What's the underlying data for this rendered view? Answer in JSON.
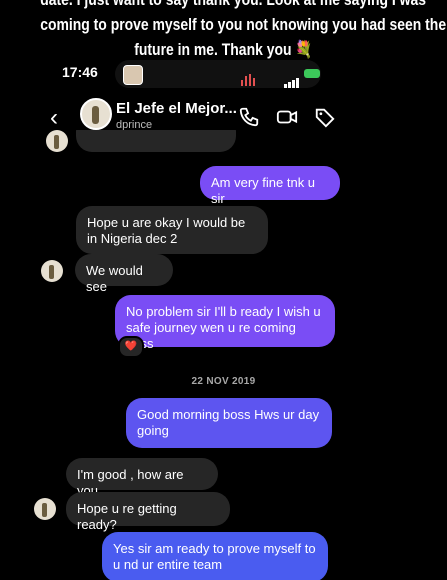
{
  "caption": {
    "line1": "date. I just want to say thank you. Look at me saying I was",
    "line2": "coming to prove myself to you not knowing you had seen the",
    "line3": "future in me. Thank you 💐"
  },
  "status_bar": {
    "time": "17:46"
  },
  "header": {
    "back_icon": "chevron-left-icon",
    "name": "El Jefe el Mejor...",
    "username": "dprince",
    "icons": [
      "phone-icon",
      "video-icon",
      "tag-icon"
    ]
  },
  "messages": [
    {
      "side": "in",
      "text": ""
    },
    {
      "side": "out",
      "text": "Am very fine tnk u sir"
    },
    {
      "side": "in",
      "text": "Hope u are okay I would be in Nigeria dec 2"
    },
    {
      "side": "in",
      "text": "We would see"
    },
    {
      "side": "out",
      "text": "No problem sir I'll b ready I wish u safe journey wen u re coming boss",
      "reaction": "❤️"
    },
    {
      "side": "date",
      "text": "22 NOV 2019"
    },
    {
      "side": "out",
      "text": "Good morning boss Hws ur day going"
    },
    {
      "side": "in",
      "text": "I'm good , how are you"
    },
    {
      "side": "in",
      "text": "Hope u re getting ready?"
    },
    {
      "side": "out",
      "text": "Yes sir am ready to prove myself to u nd ur entire team"
    }
  ],
  "colors": {
    "background": "#000000",
    "incoming": "#262626",
    "outgoing": "#7a4df5"
  }
}
